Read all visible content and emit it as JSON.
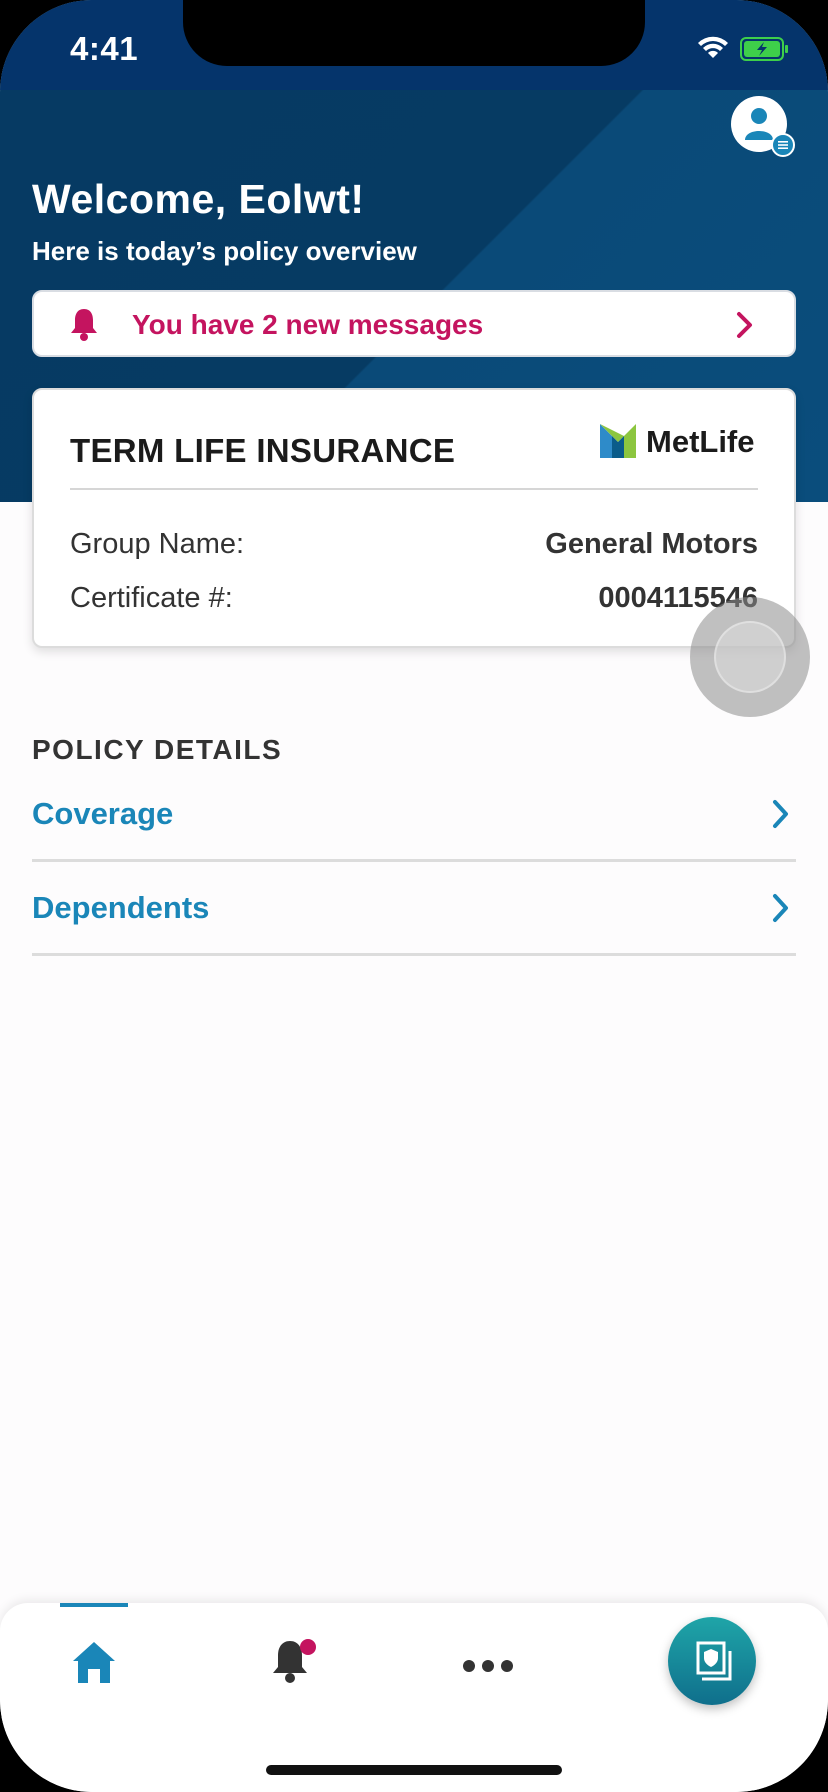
{
  "status_bar": {
    "time": "4:41"
  },
  "header": {
    "welcome": "Welcome, Eolwt!",
    "subtitle": "Here is today’s policy overview"
  },
  "messages_banner": {
    "text": "You have 2 new messages"
  },
  "policy_card": {
    "title": "TERM LIFE INSURANCE",
    "brand": "MetLife",
    "rows": [
      {
        "label": "Group Name:",
        "value": "General Motors"
      },
      {
        "label": "Certificate #:",
        "value": "0004115546"
      }
    ]
  },
  "policy_details": {
    "heading": "POLICY DETAILS",
    "items": [
      {
        "label": "Coverage"
      },
      {
        "label": "Dependents"
      }
    ]
  },
  "bottom_nav": {
    "items": [
      "home-icon",
      "notifications-icon",
      "more-icon",
      "policy-card-icon"
    ],
    "active": "home-icon"
  },
  "colors": {
    "header_bg": "#063a63",
    "accent_blue": "#1a86b8",
    "message_pink": "#c4145f",
    "fab_teal": "#1fa5a8"
  }
}
